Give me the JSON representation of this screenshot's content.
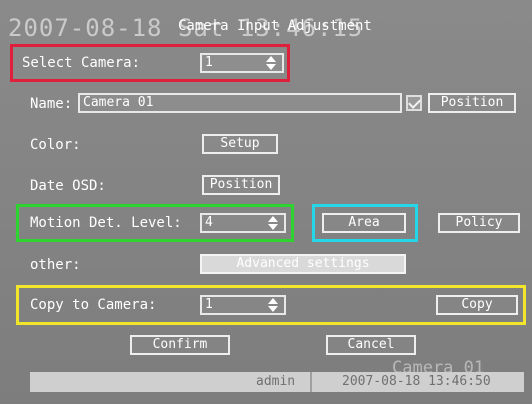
{
  "overlay": {
    "datetime": "2007-08-18 Sat 13:46:15",
    "camera_name": "Camera 01"
  },
  "dialog": {
    "title": "Camera Input Adjustment",
    "select_camera": {
      "label": "Select Camera:",
      "value": "1"
    },
    "name": {
      "label": "Name:",
      "value": "Camera 01",
      "position_button": "Position"
    },
    "color": {
      "label": "Color:",
      "setup_button": "Setup"
    },
    "date_osd": {
      "label": "Date OSD:",
      "position_button": "Position"
    },
    "motion": {
      "label": "Motion Det. Level:",
      "value": "4",
      "area_button": "Area",
      "policy_button": "Policy"
    },
    "other": {
      "label": "other:",
      "advanced_button": "Advanced settings"
    },
    "copy": {
      "label": "Copy to Camera:",
      "value": "1",
      "copy_button": "Copy"
    },
    "confirm_button": "Confirm",
    "cancel_button": "Cancel"
  },
  "statusbar": {
    "user": "admin",
    "datetime": "2007-08-18 13:46:50"
  },
  "highlights": {
    "select_camera": "#e0203a",
    "motion_level": "#2fd32f",
    "area": "#25d6e8",
    "copy_row": "#f2e62a"
  }
}
